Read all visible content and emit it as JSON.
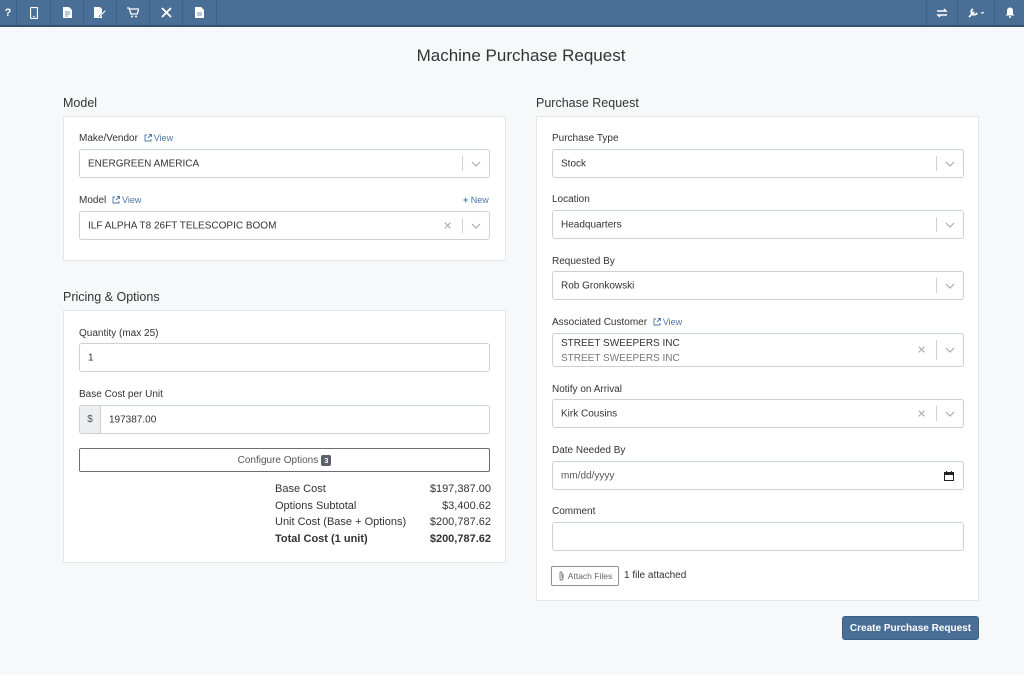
{
  "nav": {
    "left_icons": [
      "help-icon",
      "mobile-icon",
      "document-icon",
      "edit-document-icon",
      "cart-icon",
      "tools-icon",
      "file-icon"
    ],
    "right_icons": [
      "transfer-icon",
      "wrench-icon",
      "bell-icon"
    ],
    "help_glyph": "?"
  },
  "page": {
    "title": "Machine Purchase Request"
  },
  "model_section": {
    "title": "Model",
    "make_label": "Make/Vendor",
    "make_view": "View",
    "make_value": "ENERGREEN AMERICA",
    "model_label": "Model",
    "model_view": "View",
    "model_new": "New",
    "model_value": "ILF ALPHA T8 26FT TELESCOPIC BOOM"
  },
  "pricing_section": {
    "title": "Pricing & Options",
    "quantity_label": "Quantity (max 25)",
    "quantity_value": "1",
    "base_cost_label": "Base Cost per Unit",
    "currency_symbol": "$",
    "base_cost_value": "197387.00",
    "configure_label": "Configure Options",
    "configure_count": "3",
    "summary": [
      {
        "label": "Base Cost",
        "amount": "$197,387.00"
      },
      {
        "label": "Options Subtotal",
        "amount": "$3,400.62"
      },
      {
        "label": "Unit Cost (Base + Options)",
        "amount": "$200,787.62"
      },
      {
        "label": "Total Cost (1 unit)",
        "amount": "$200,787.62"
      }
    ]
  },
  "purchase_section": {
    "title": "Purchase Request",
    "purchase_type_label": "Purchase Type",
    "purchase_type_value": "Stock",
    "location_label": "Location",
    "location_value": "Headquarters",
    "requested_by_label": "Requested By",
    "requested_by_value": "Rob Gronkowski",
    "customer_label": "Associated Customer",
    "customer_view": "View",
    "customer_value": "STREET SWEEPERS INC",
    "customer_subvalue": "STREET SWEEPERS INC",
    "notify_label": "Notify on Arrival",
    "notify_value": "Kirk Cousins",
    "date_label": "Date Needed By",
    "date_placeholder": "mm/dd/yyyy",
    "comment_label": "Comment",
    "comment_value": "",
    "attach_label": "Attach Files",
    "attach_note": "1 file attached"
  },
  "actions": {
    "create_label": "Create Purchase Request"
  },
  "colors": {
    "nav": "#4a6f96",
    "accent": "#4a78a6",
    "background": "#f7f8fa"
  }
}
